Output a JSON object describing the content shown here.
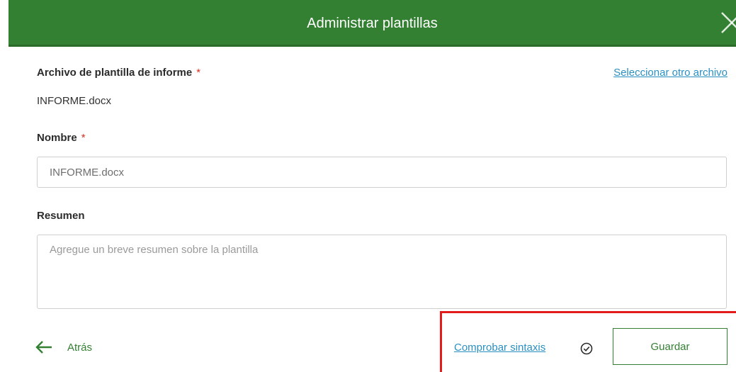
{
  "dialog": {
    "title": "Administrar plantillas",
    "close_icon": "close-icon",
    "header_color": "#338033"
  },
  "template_file": {
    "label": "Archivo de plantilla de informe",
    "required_mark": "*",
    "file_name": "INFORME.docx",
    "select_other_link": "Seleccionar otro archivo"
  },
  "name_field": {
    "label": "Nombre",
    "required_mark": "*",
    "value": "INFORME.docx"
  },
  "summary_field": {
    "label": "Resumen",
    "value": "",
    "placeholder": "Agregue un breve resumen sobre la plantilla"
  },
  "footer": {
    "back_label": "Atrás",
    "back_icon": "arrow-left-icon",
    "check_syntax_link": "Comprobar sintaxis",
    "check_icon": "check-circle-icon",
    "save_label": "Guardar"
  },
  "colors": {
    "accent": "#338033",
    "link": "#2a8fc1",
    "required": "#d83020",
    "highlight": "#e31b1b"
  }
}
